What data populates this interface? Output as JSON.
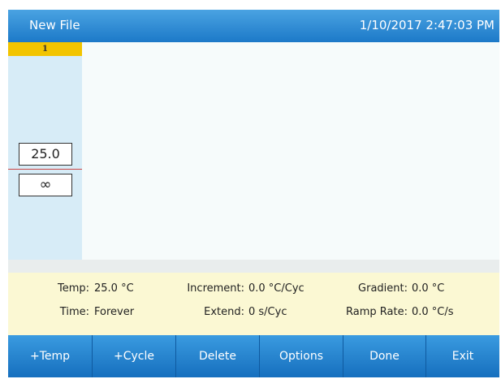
{
  "titlebar": {
    "title": "New File",
    "datetime": "1/10/2017 2:47:03 PM"
  },
  "program": {
    "step_number": "1",
    "temperature": "25.0",
    "time": "∞"
  },
  "info": {
    "temp_label": "Temp:",
    "temp_value": "25.0 °C",
    "time_label": "Time:",
    "time_value": "Forever",
    "increment_label": "Increment:",
    "increment_value": "0.0 °C/Cyc",
    "extend_label": "Extend:",
    "extend_value": "0 s/Cyc",
    "gradient_label": "Gradient:",
    "gradient_value": "0.0 °C",
    "ramp_label": "Ramp Rate:",
    "ramp_value": "0.0 °C/s"
  },
  "buttons": {
    "add_temp": "+Temp",
    "add_cycle": "+Cycle",
    "delete": "Delete",
    "options": "Options",
    "done": "Done",
    "exit": "Exit"
  },
  "colors": {
    "titlebar": "#1c79c8",
    "step_header": "#f2c400",
    "step_column": "#d7ecf7",
    "info_panel": "#fbf8d3",
    "marker_line": "#cc4444"
  }
}
